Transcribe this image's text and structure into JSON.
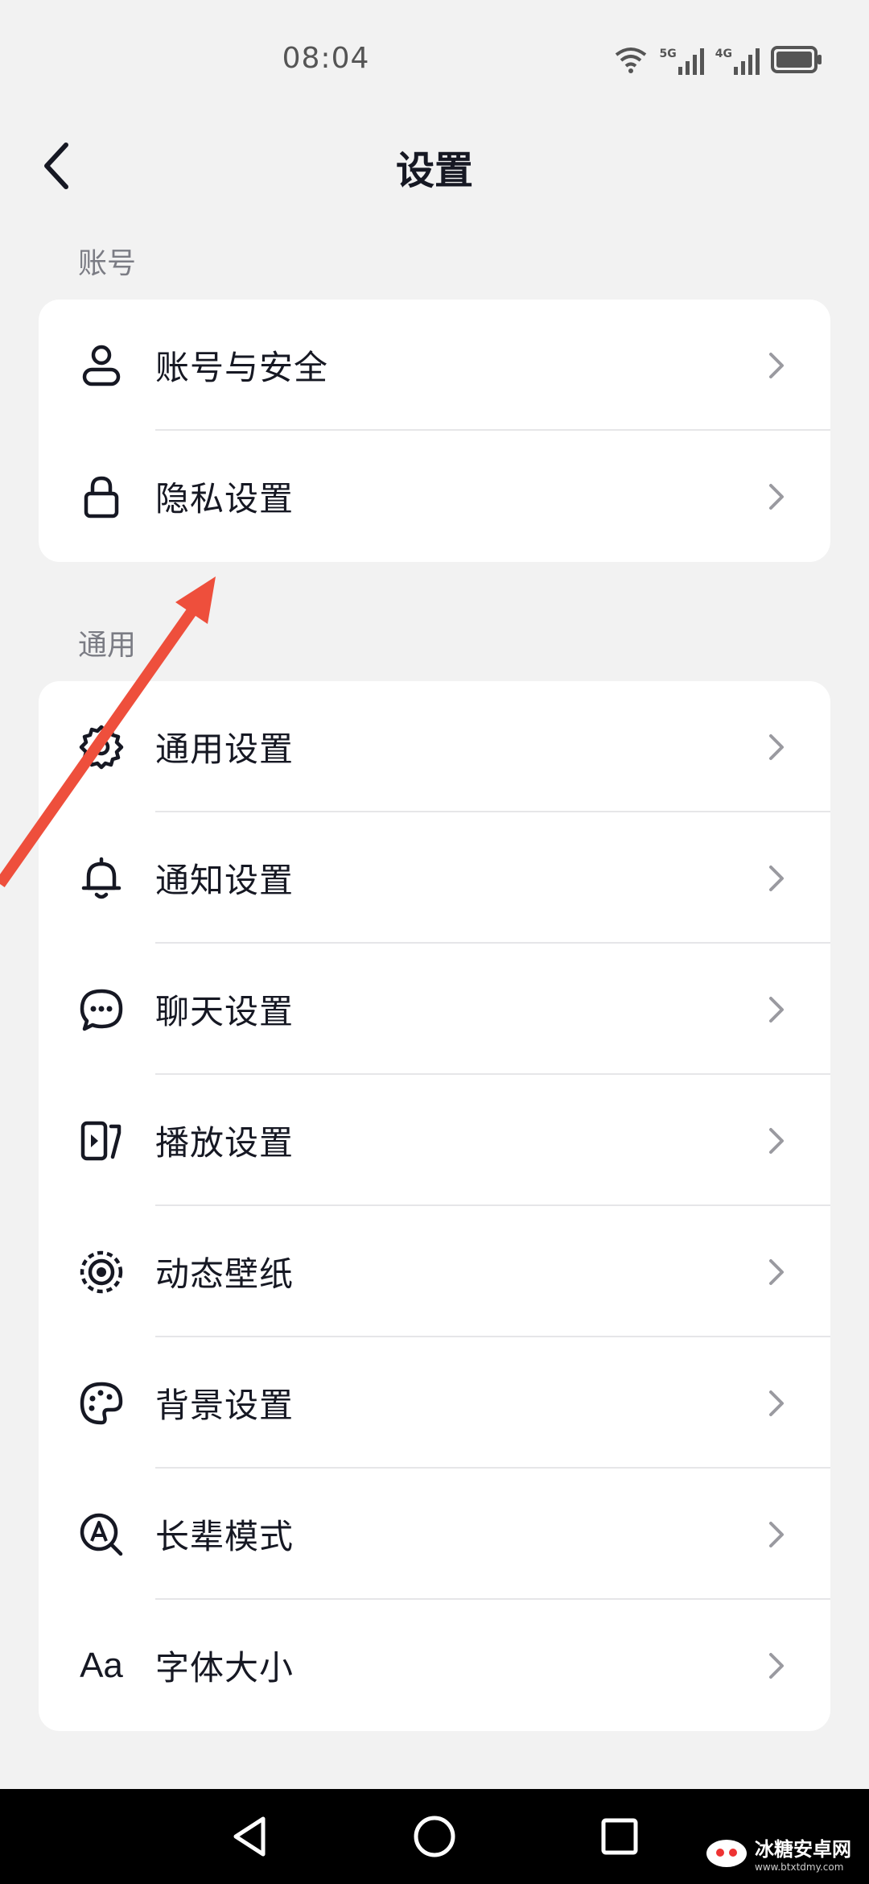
{
  "status_bar": {
    "time": "08:04",
    "network_5g": "5G",
    "network_4g": "4G",
    "icons": [
      "wifi-icon",
      "signal-5g-icon",
      "signal-4g-icon",
      "battery-icon"
    ]
  },
  "header": {
    "title": "设置",
    "back_icon": "chevron-left-icon"
  },
  "sections": [
    {
      "label": "账号",
      "items": [
        {
          "label": "账号与安全",
          "icon": "user-icon"
        },
        {
          "label": "隐私设置",
          "icon": "lock-icon"
        }
      ]
    },
    {
      "label": "通用",
      "items": [
        {
          "label": "通用设置",
          "icon": "gear-icon"
        },
        {
          "label": "通知设置",
          "icon": "bell-icon"
        },
        {
          "label": "聊天设置",
          "icon": "chat-bubble-icon"
        },
        {
          "label": "播放设置",
          "icon": "play-icon"
        },
        {
          "label": "动态壁纸",
          "icon": "dynamic-wallpaper-icon"
        },
        {
          "label": "背景设置",
          "icon": "palette-icon"
        },
        {
          "label": "长辈模式",
          "icon": "elder-mode-icon"
        },
        {
          "label": "字体大小",
          "icon": "font-size-icon",
          "icon_text": "Aa"
        }
      ]
    }
  ],
  "annotation": {
    "icon": "red-arrow-annotation",
    "color": "#ee4f3c"
  },
  "system_nav": {
    "icons": [
      "back-triangle-icon",
      "home-circle-icon",
      "recents-square-icon"
    ]
  },
  "watermark": {
    "text": "冰糖安卓网",
    "sub": "www.btxtdmy.com"
  },
  "colors": {
    "background": "#f2f2f2",
    "card": "#ffffff",
    "text": "#161823",
    "secondary": "#7b7c84",
    "chevron": "#9a9aa0"
  }
}
